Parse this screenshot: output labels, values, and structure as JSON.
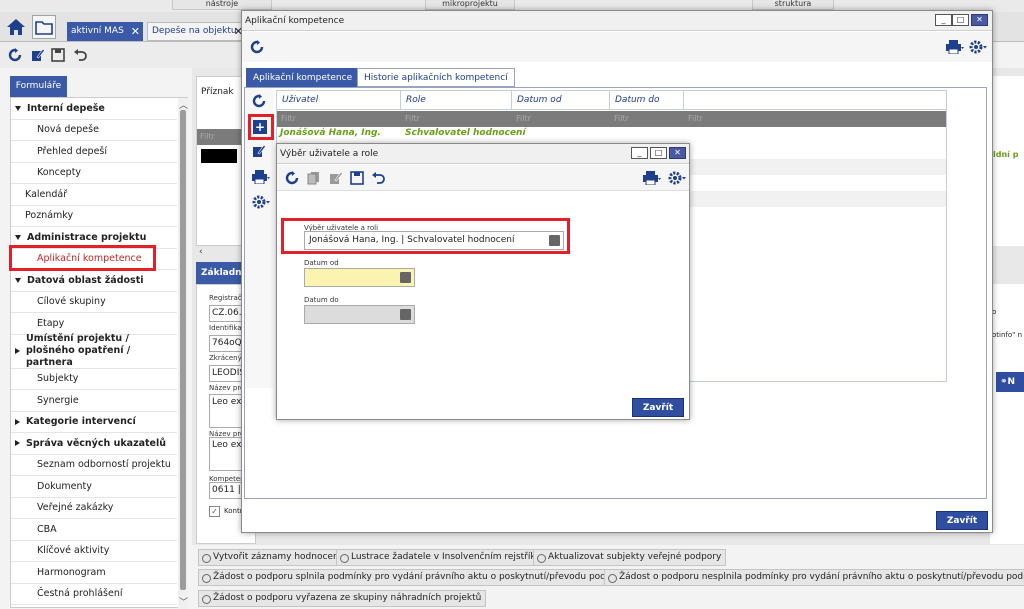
{
  "top_tabs": [
    "nástroje",
    "mikroprojektu",
    "struktura"
  ],
  "app_tabs": [
    {
      "label": "aktivní MAS",
      "active": true
    },
    {
      "label": "Depeše na objektu",
      "active": false
    }
  ],
  "sidebar": {
    "header": "Formuláře",
    "items": [
      {
        "label": "Interní depeše",
        "kind": "group-open"
      },
      {
        "label": "Nová depeše",
        "kind": "sub"
      },
      {
        "label": "Přehled depeší",
        "kind": "sub"
      },
      {
        "label": "Koncepty",
        "kind": "sub"
      },
      {
        "label": "Kalendář",
        "kind": "top"
      },
      {
        "label": "Poznámky",
        "kind": "top"
      },
      {
        "label": "Administrace projektu",
        "kind": "group-open"
      },
      {
        "label": "Aplikační kompetence",
        "kind": "sub-selected"
      },
      {
        "label": "Datová oblast žádosti",
        "kind": "group-open"
      },
      {
        "label": "Cílové skupiny",
        "kind": "sub"
      },
      {
        "label": "Etapy",
        "kind": "sub"
      },
      {
        "label": "Umístění projektu / plošného opatření / partnera",
        "kind": "group-closed"
      },
      {
        "label": "Subjekty",
        "kind": "sub"
      },
      {
        "label": "Synergie",
        "kind": "sub"
      },
      {
        "label": "Kategorie intervencí",
        "kind": "group-closed"
      },
      {
        "label": "Správa věcných ukazatelů",
        "kind": "group-closed"
      },
      {
        "label": "Seznam odborností projektu",
        "kind": "sub"
      },
      {
        "label": "Dokumenty",
        "kind": "sub"
      },
      {
        "label": "Veřejné zakázky",
        "kind": "sub"
      },
      {
        "label": "CBA",
        "kind": "sub"
      },
      {
        "label": "Klíčové aktivity",
        "kind": "sub"
      },
      {
        "label": "Harmonogram",
        "kind": "sub"
      },
      {
        "label": "Čestná prohlášení",
        "kind": "sub"
      }
    ]
  },
  "background": {
    "priznak_label": "Příznak",
    "filter_placeholder": "Filtr",
    "zakladni_label": "Základní i",
    "fields": [
      {
        "label": "Registrač",
        "value": "CZ.06.1"
      },
      {
        "label": "Identifikac",
        "value": "764oQF"
      },
      {
        "label": "Zkrácený n",
        "value": "LEODIS"
      },
      {
        "label": "Název proj",
        "value": "Leo exp"
      },
      {
        "label": "Název proj",
        "value": "Leo exp"
      },
      {
        "label": "Kompetenc",
        "value": "0611 |"
      }
    ],
    "checkbox_label": "Kontr",
    "right_texts": [
      "ldní p",
      "o",
      "otinfo\" n"
    ],
    "right_button": "N"
  },
  "actions": [
    "Vytvořit záznamy hodnocení",
    "Lustrace žadatele v Insolvenčním rejstříku",
    "Aktualizovat subjekty veřejné podpory",
    "Žádost o podporu splnila podmínky pro vydání právního aktu o poskytnutí/převodu podpory",
    "Žádost o podporu nesplnila podmínky pro vydání právního aktu o poskytnutí/převodu podpory",
    "Žádost o podporu vyřazena ze skupiny náhradních projektů"
  ],
  "dialog1": {
    "title": "Aplikační kompetence",
    "tabs": [
      "Aplikační kompetence",
      "Historie aplikačních kompetencí"
    ],
    "columns": [
      "Uživatel",
      "Role",
      "Datum od",
      "Datum do"
    ],
    "filter_placeholder": "Filtr",
    "rows": [
      {
        "user": "Jonášová Hana, Ing.",
        "role": "Schvalovatel hodnocení",
        "from": "",
        "to": ""
      }
    ],
    "close_label": "Zavřít"
  },
  "dialog2": {
    "title": "Výběr uživatele a role",
    "select_label": "Výběr uživatele a roli",
    "select_value": "Jonášová Hana, Ing. | Schvalovatel hodnocení",
    "date_from_label": "Datum od",
    "date_from_value": "",
    "date_to_label": "Datum do",
    "date_to_value": "",
    "close_label": "Zavřít"
  },
  "colors": {
    "accent": "#2f4ea0",
    "tab_active": "#3a5aa8",
    "highlight": "#e0202a",
    "row_text": "#6aa018",
    "date_from_bg": "#fbf3b0"
  }
}
